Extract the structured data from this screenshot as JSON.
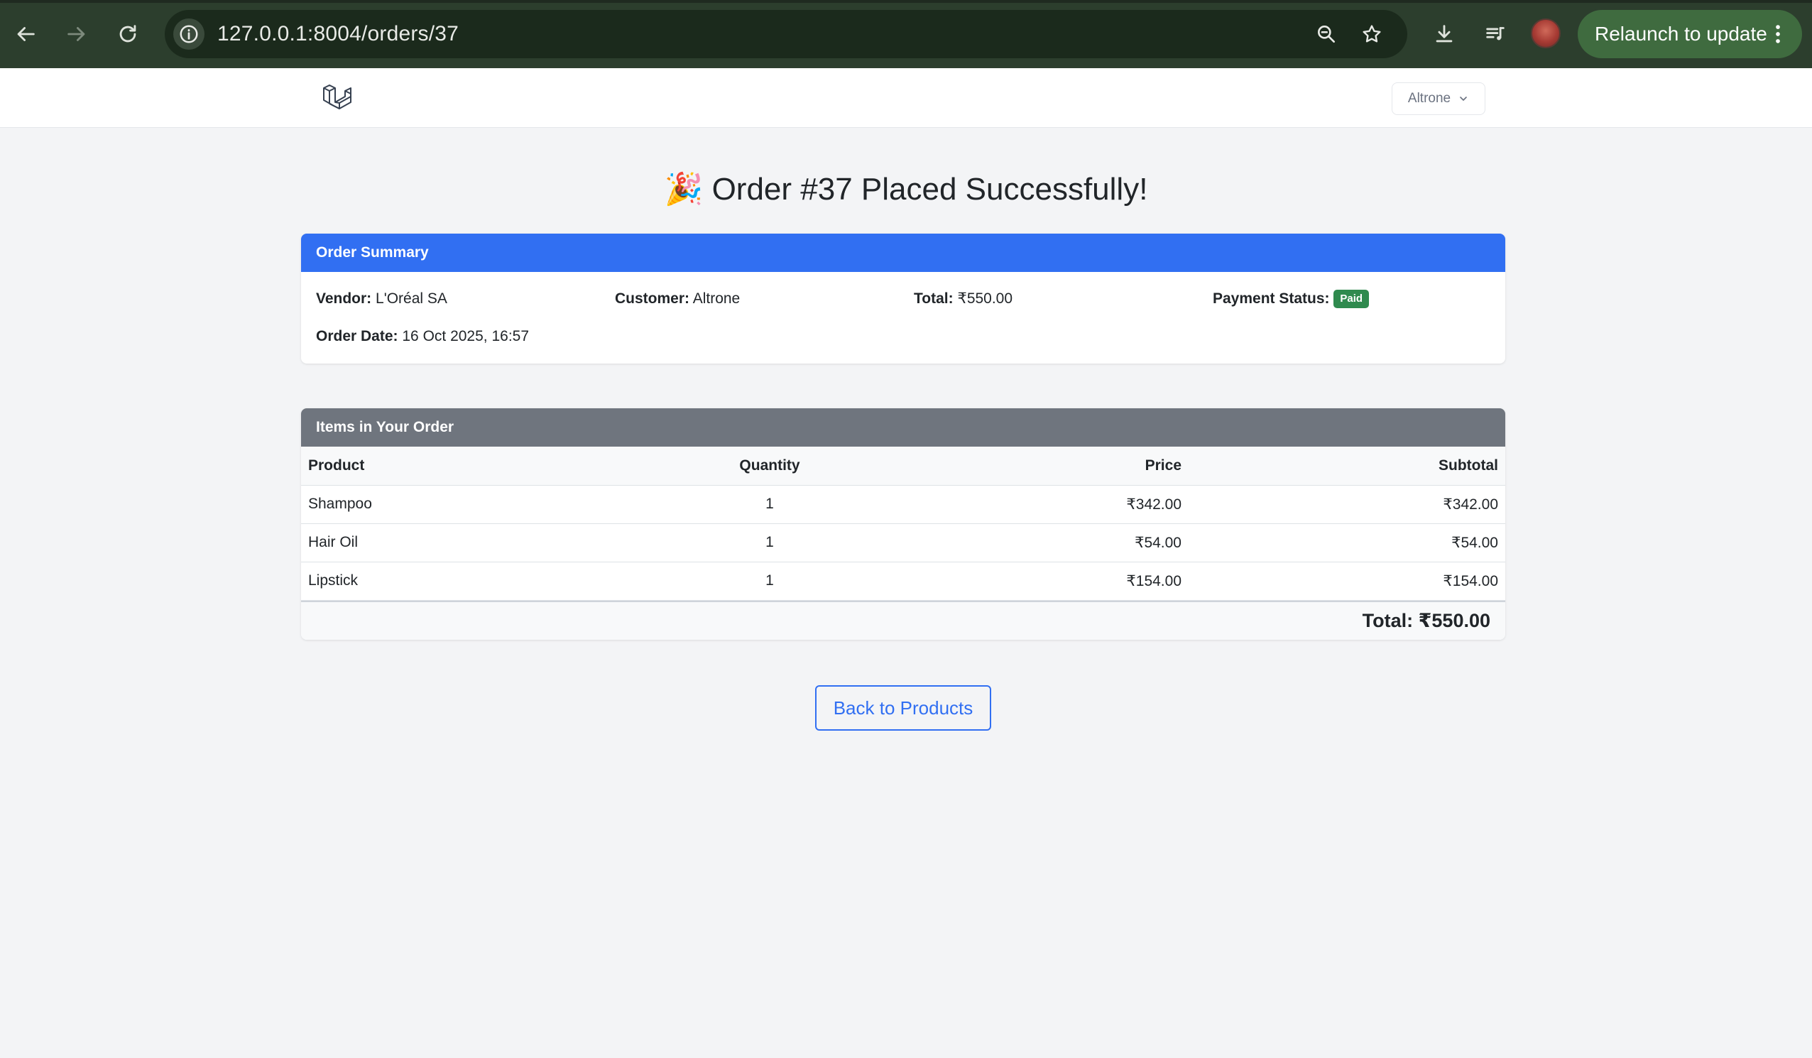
{
  "browser": {
    "url": "127.0.0.1:8004/orders/37",
    "relaunch_label": "Relaunch to update"
  },
  "navbar": {
    "user_name": "Altrone"
  },
  "page": {
    "title_emoji": "🎉",
    "title": "Order #37 Placed Successfully!"
  },
  "summary": {
    "header": "Order Summary",
    "vendor_label": "Vendor:",
    "vendor": "L'Oréal SA",
    "customer_label": "Customer:",
    "customer": "Altrone",
    "total_label": "Total:",
    "total": "₹550.00",
    "payment_status_label": "Payment Status:",
    "payment_status": "Paid",
    "order_date_label": "Order Date:",
    "order_date": "16 Oct 2025, 16:57"
  },
  "items": {
    "header": "Items in Your Order",
    "columns": [
      "Product",
      "Quantity",
      "Price",
      "Subtotal"
    ],
    "rows": [
      [
        "Shampoo",
        "1",
        "₹342.00",
        "₹342.00"
      ],
      [
        "Hair Oil",
        "1",
        "₹54.00",
        "₹54.00"
      ],
      [
        "Lipstick",
        "1",
        "₹154.00",
        "₹154.00"
      ]
    ],
    "total_text": "Total: ₹550.00"
  },
  "actions": {
    "back_label": "Back to Products"
  },
  "colors": {
    "primary": "#316ff2",
    "secondary_header": "#6f757e",
    "success_badge": "#2f8a4e",
    "chrome_bg": "#2c3e2d"
  }
}
